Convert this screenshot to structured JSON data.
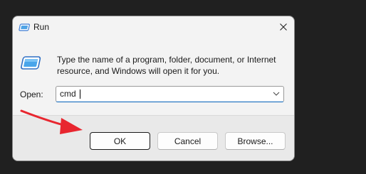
{
  "window": {
    "title": "Run",
    "close_glyph": "✕",
    "icon": "run-app-icon"
  },
  "body": {
    "description": "Type the name of a program, folder, document, or Internet resource, and Windows will open it for you.",
    "open_label": "Open:",
    "command_value": "cmd",
    "icon": "run-program-icon"
  },
  "buttons": {
    "ok": "OK",
    "cancel": "Cancel",
    "browse": "Browse..."
  },
  "annotation": {
    "arrow_color": "#e8262f",
    "target": "OK"
  },
  "colors": {
    "accent": "#005fb8",
    "dialog_bg": "#f3f3f3",
    "footer_bg": "#e9e9e9",
    "backdrop": "#202020"
  }
}
